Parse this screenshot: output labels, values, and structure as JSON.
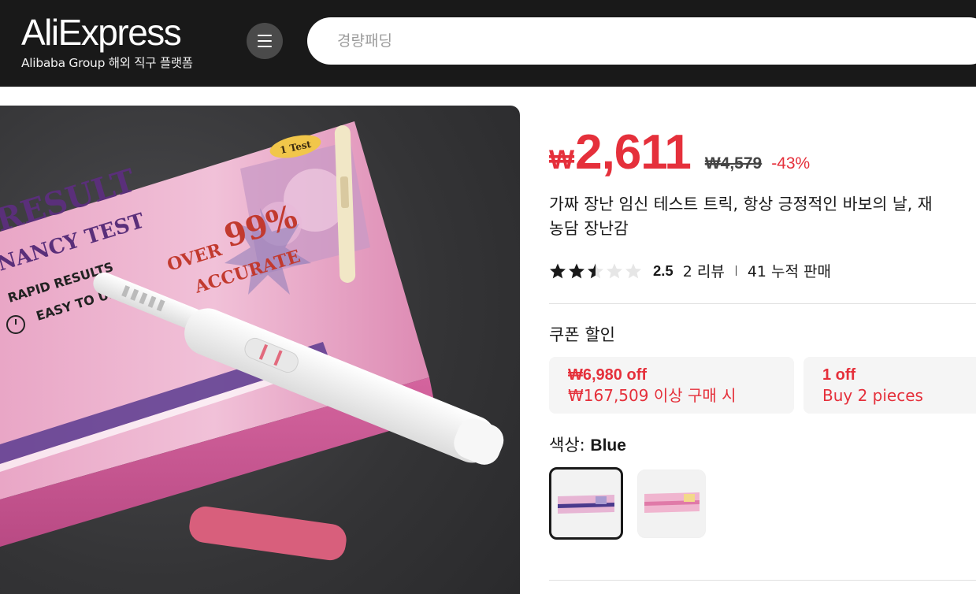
{
  "header": {
    "logo": "AliExpress",
    "logo_sub": "Alibaba Group 해외 직구 플랫폼",
    "search_placeholder": "경량패딩"
  },
  "gallery": {
    "box_texts": [
      "1 Test",
      "RESULT",
      "NANCY TEST",
      "RAPID RESULTS",
      "EASY TO USE",
      "OVER",
      "99%",
      "ACCURATE"
    ]
  },
  "product": {
    "price_currency": "₩",
    "price": "2,611",
    "original_price": "₩4,579",
    "discount": "-43%",
    "title_line1": "가짜 장난 임신 테스트 트릭, 항상 긍정적인 바보의 날, 재",
    "title_line2": "농담 장난감",
    "rating": "2.5",
    "rating_value": 2.5,
    "reviews": "2 리뷰",
    "sold": "41 누적 판매"
  },
  "coupons": {
    "heading": "쿠폰 할인",
    "items": [
      {
        "amount": "₩6,980 off",
        "condition": "₩167,509 이상 구매 시"
      },
      {
        "amount": "1 off",
        "condition": "Buy 2 pieces"
      }
    ]
  },
  "color": {
    "label": "색상:",
    "selected": "Blue"
  },
  "colors": {
    "price_red": "#e5303b",
    "header_bg": "#191919",
    "box_pink": "#e58fb6"
  }
}
